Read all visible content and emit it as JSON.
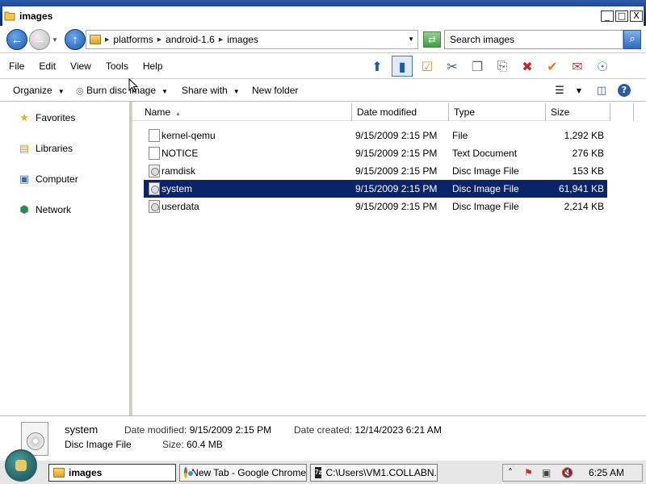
{
  "window": {
    "title": "images",
    "min_glyph": "_",
    "max_glyph": "□",
    "close_glyph": "X"
  },
  "address": {
    "breadcrumbs": [
      "platforms",
      "android-1.6",
      "images"
    ],
    "search_placeholder": "Search images"
  },
  "menu": [
    "File",
    "Edit",
    "View",
    "Tools",
    "Help"
  ],
  "toolbar_icons": [
    "up-folder-icon",
    "preview-pane-icon",
    "folder-options-icon",
    "cut-icon",
    "copy-icon",
    "paste-icon",
    "delete-icon",
    "check-icon",
    "mail-icon",
    "globe-icon"
  ],
  "commands": {
    "organize": "Organize",
    "burn": "Burn disc image",
    "share": "Share with",
    "new_folder": "New folder"
  },
  "nav": {
    "favorites": "Favorites",
    "libraries": "Libraries",
    "computer": "Computer",
    "network": "Network"
  },
  "columns": {
    "name": "Name",
    "date": "Date modified",
    "type": "Type",
    "size": "Size"
  },
  "files": [
    {
      "name": "kernel-qemu",
      "date": "9/15/2009 2:15 PM",
      "type": "File",
      "size": "1,292 KB"
    },
    {
      "name": "NOTICE",
      "date": "9/15/2009 2:15 PM",
      "type": "Text Document",
      "size": "276 KB"
    },
    {
      "name": "ramdisk",
      "date": "9/15/2009 2:15 PM",
      "type": "Disc Image File",
      "size": "153 KB"
    },
    {
      "name": "system",
      "date": "9/15/2009 2:15 PM",
      "type": "Disc Image File",
      "size": "61,941 KB"
    },
    {
      "name": "userdata",
      "date": "9/15/2009 2:15 PM",
      "type": "Disc Image File",
      "size": "2,214 KB"
    }
  ],
  "details": {
    "name": "system",
    "type": "Disc Image File",
    "modified_label": "Date modified:",
    "modified": "9/15/2009 2:15 PM",
    "created_label": "Date created:",
    "created": "12/14/2023 6:21 AM",
    "size_label": "Size:",
    "size": "60.4 MB"
  },
  "taskbar": {
    "tasks": [
      "images",
      "New Tab - Google Chrome",
      "C:\\Users\\VM1.COLLABN..."
    ],
    "clock": "6:25 AM"
  }
}
